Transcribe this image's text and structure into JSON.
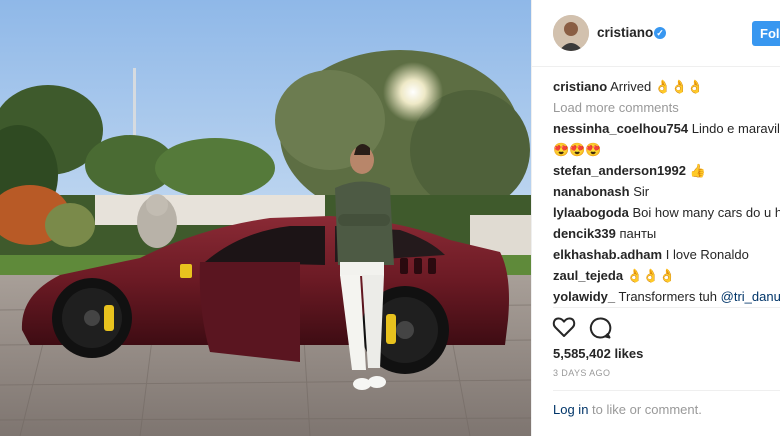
{
  "post": {
    "username": "cristiano",
    "verified_icon": "verified-badge-icon",
    "follow_label": "Follow",
    "caption_user": "cristiano",
    "caption_text": "Arrived 👌👌👌",
    "load_more": "Load more comments",
    "comments": [
      {
        "user": "nessinha_coelhou754",
        "text": "Lindo e maravilhoso",
        "line2": "😍😍😍"
      },
      {
        "user": "stefan_anderson1992",
        "text": "👍"
      },
      {
        "user": "nanabonash",
        "text": "Sir"
      },
      {
        "user": "lylaabogoda",
        "text": "Boi how many cars do u have"
      },
      {
        "user": "dencik339",
        "text": "панты"
      },
      {
        "user": "elkhashab.adham",
        "text": "I love Ronaldo"
      },
      {
        "user": "zaul_tejeda",
        "text": "👌👌👌"
      },
      {
        "user": "yolawidy_",
        "text": "Transformers tuh",
        "mention": "@tri_danu"
      }
    ],
    "likes": "5,585,402 likes",
    "time_ago": "3 DAYS AGO",
    "login_link": "Log in",
    "login_suffix": " to like or comment."
  },
  "icons": {
    "like": "heart-icon",
    "comment": "comment-bubble-icon"
  },
  "colors": {
    "accent": "#3897f0",
    "link": "#003569",
    "muted": "#999999"
  }
}
